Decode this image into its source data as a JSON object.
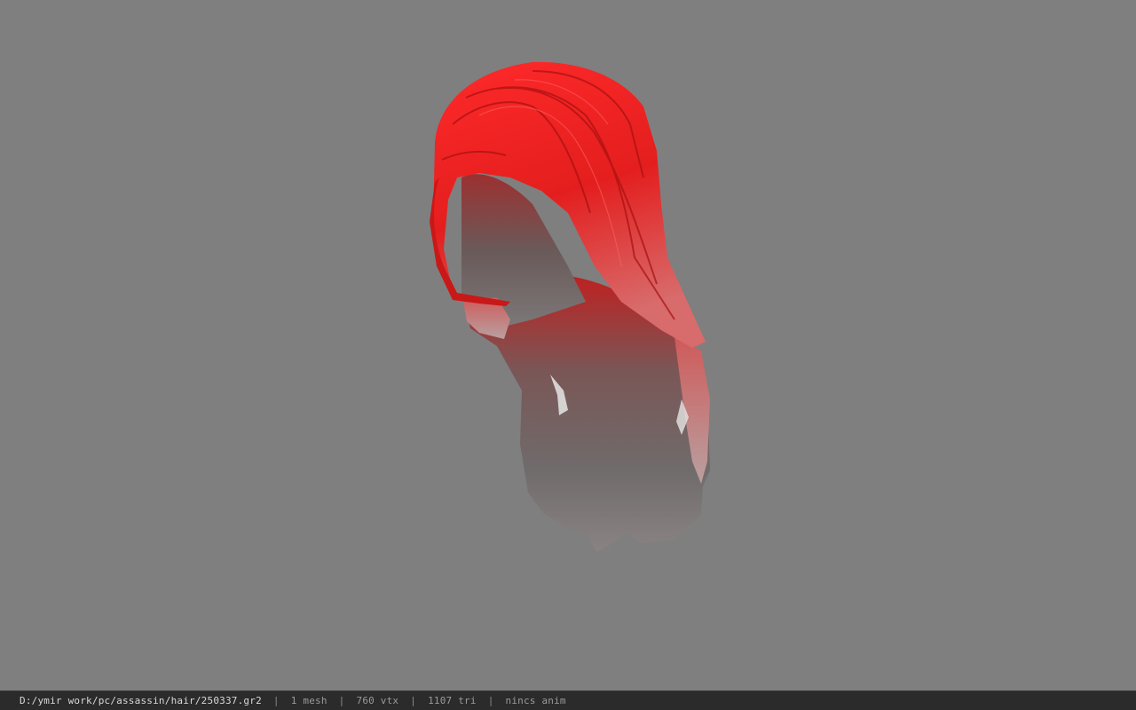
{
  "viewport": {
    "background": "#7f7f7f",
    "model": "hair mesh",
    "hair_color": "#e02020"
  },
  "statusbar": {
    "file_path": "D:/ymir work/pc/assassin/hair/250337.gr2",
    "separator": "|",
    "mesh_count": "1 mesh",
    "vertex_count": "760 vtx",
    "triangle_count": "1107 tri",
    "anim_status": "nincs anim"
  }
}
